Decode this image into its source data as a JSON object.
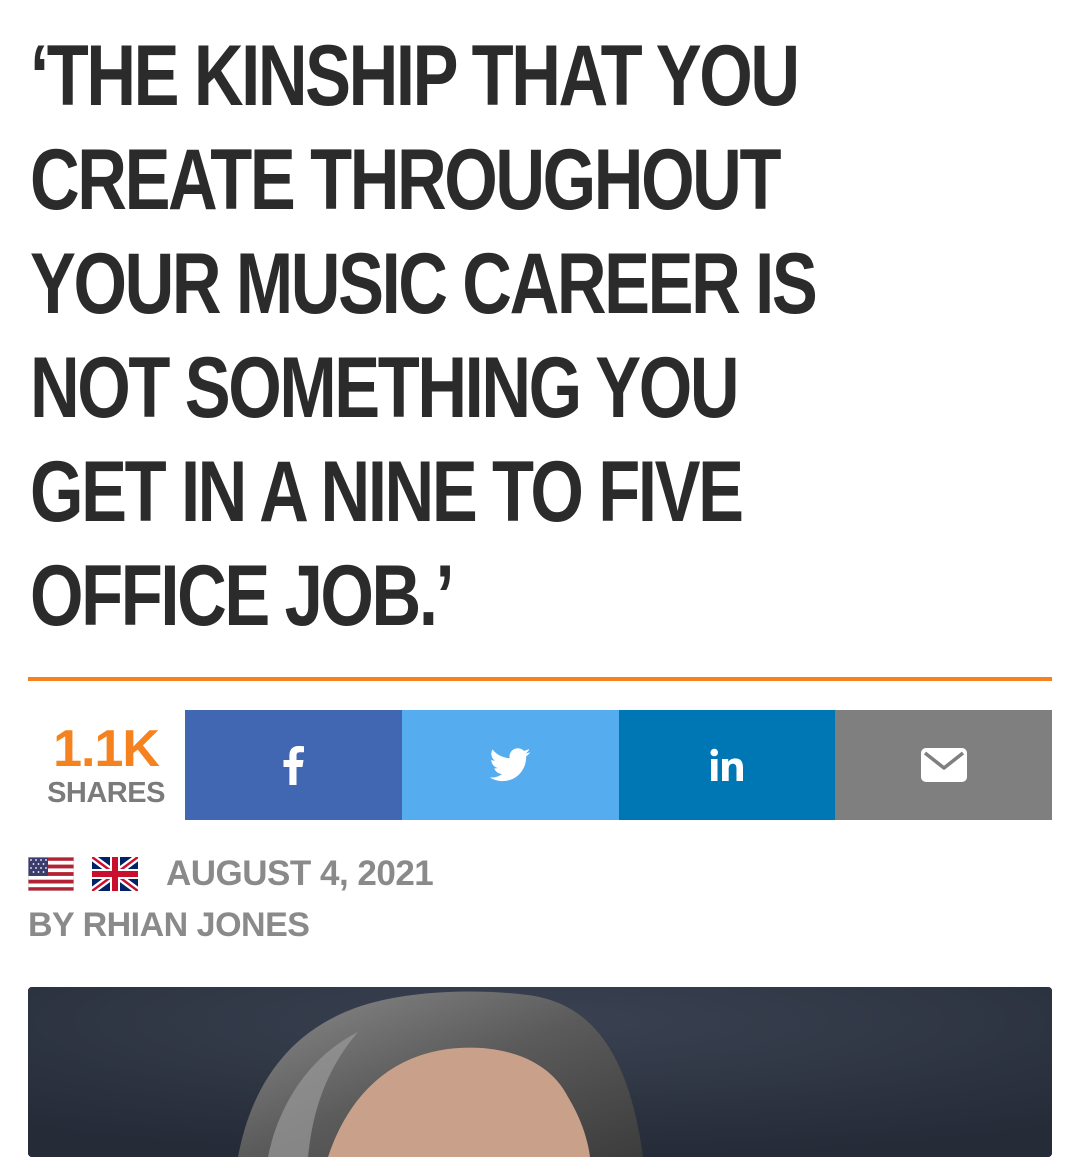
{
  "article": {
    "headline": "‘THE KINSHIP THAT YOU\nCREATE THROUGHOUT\nYOUR MUSIC CAREER IS\nNOT SOMETHING YOU\nGET IN A NINE TO FIVE\nOFFICE JOB.’",
    "date": "AUGUST 4, 2021",
    "byline": "BY RHIAN JONES"
  },
  "shares": {
    "count": "1.1K",
    "label": "SHARES"
  },
  "share_buttons": [
    {
      "network": "facebook",
      "icon": "facebook-icon",
      "color": "#4267b2"
    },
    {
      "network": "twitter",
      "icon": "twitter-icon",
      "color": "#55acee"
    },
    {
      "network": "linkedin",
      "icon": "linkedin-icon",
      "color": "#0077b5"
    },
    {
      "network": "email",
      "icon": "mail-icon",
      "color": "#7f7f7f"
    }
  ],
  "edition_flags": [
    "us-flag-icon",
    "uk-flag-icon"
  ],
  "colors": {
    "accent": "#f5821f",
    "headline": "#2b2b2b",
    "meta": "#8a8a8a"
  }
}
